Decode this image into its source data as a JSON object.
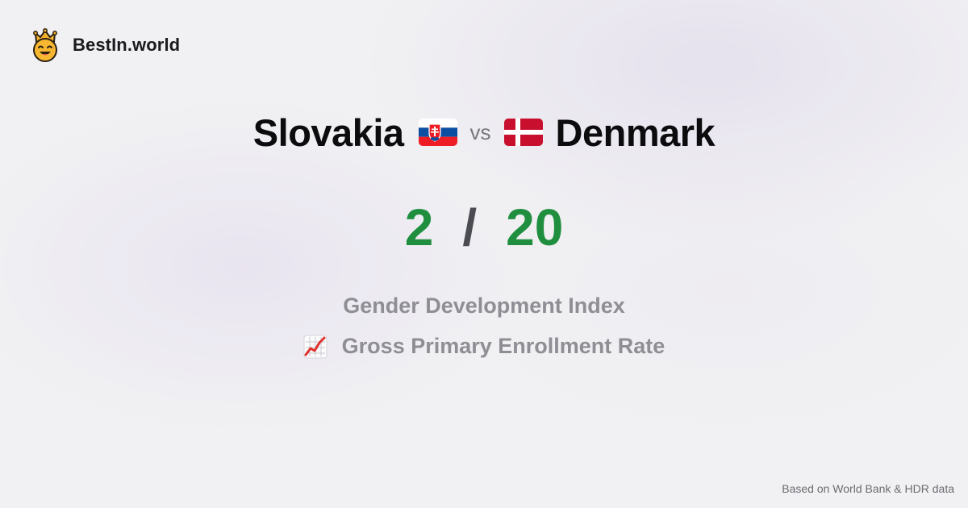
{
  "brand": {
    "name": "BestIn.world",
    "logo_icon": "crowned-smiley-logo"
  },
  "comparison": {
    "left_country": "Slovakia",
    "left_flag": "slovakia-flag-icon",
    "vs_label": "vs",
    "right_country": "Denmark",
    "right_flag": "denmark-flag-icon"
  },
  "score": {
    "left_rank": "2",
    "separator": "/",
    "right_rank": "20",
    "color": "#1f8f3f"
  },
  "metrics": {
    "primary": "Gender Development Index",
    "secondary": "Gross Primary Enrollment Rate",
    "secondary_icon": "chart-increasing-icon"
  },
  "footer": {
    "source_text": "Based on World Bank & HDR data"
  }
}
